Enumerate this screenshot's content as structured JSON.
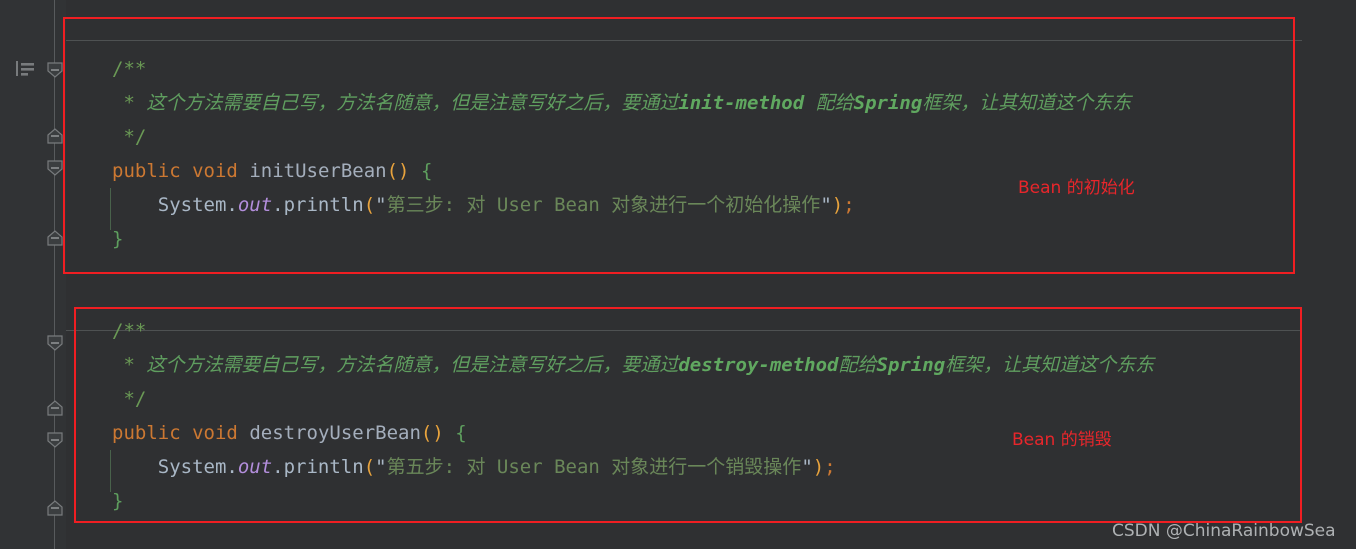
{
  "editor": {
    "theme_background": "#2F3032",
    "gutter_background": "#313335",
    "annotation_color": "#F01E22",
    "comment_color": "#5F9E5F",
    "keyword_color": "#CC7832",
    "string_color": "#6A8759"
  },
  "gutter": {
    "bookmark_icon": "bookmark-lines-icon",
    "fold_markers": [
      {
        "type": "fold-collapse-start"
      },
      {
        "type": "fold-collapse-end"
      },
      {
        "type": "fold-collapse-start"
      },
      {
        "type": "fold-collapse-end"
      },
      {
        "type": "fold-collapse-start"
      },
      {
        "type": "fold-collapse-end"
      },
      {
        "type": "fold-collapse-start"
      },
      {
        "type": "fold-collapse-end"
      }
    ]
  },
  "blocks": [
    {
      "id": "init-bean-block",
      "label": "Bean 的初始化",
      "lines": [
        {
          "id": "comment-open",
          "segments": [
            {
              "cls": "cmt-plain",
              "text": "/**"
            }
          ]
        },
        {
          "id": "comment-body",
          "segments": [
            {
              "cls": "cmt-plain",
              "text": " * "
            },
            {
              "cls": "cmt",
              "text": "这个方法需要自己写，方法名随意，但是注意写好之后，要通过"
            },
            {
              "cls": "cmt-b",
              "text": "init-method"
            },
            {
              "cls": "cmt",
              "text": " 配给"
            },
            {
              "cls": "cmt-b",
              "text": "Spring"
            },
            {
              "cls": "cmt",
              "text": "框架，让其知道这个东东"
            }
          ]
        },
        {
          "id": "comment-close",
          "segments": [
            {
              "cls": "cmt-plain",
              "text": " */"
            }
          ]
        },
        {
          "id": "method-signature",
          "segments": [
            {
              "cls": "kw",
              "text": "public"
            },
            {
              "cls": "ident",
              "text": " "
            },
            {
              "cls": "kw",
              "text": "void"
            },
            {
              "cls": "ident",
              "text": " "
            },
            {
              "cls": "mname",
              "text": "initUserBean"
            },
            {
              "cls": "paren",
              "text": "()"
            },
            {
              "cls": "ident",
              "text": " "
            },
            {
              "cls": "brace",
              "text": "{"
            }
          ]
        },
        {
          "id": "println-statement",
          "segments": [
            {
              "cls": "ident",
              "text": "    System."
            },
            {
              "cls": "field",
              "text": "out"
            },
            {
              "cls": "ident",
              "text": ".println"
            },
            {
              "cls": "paren",
              "text": "("
            },
            {
              "cls": "ident",
              "text": "\""
            },
            {
              "cls": "str",
              "text": "第三步: 对 User Bean 对象进行一个初始化操作"
            },
            {
              "cls": "ident",
              "text": "\""
            },
            {
              "cls": "paren",
              "text": ")"
            },
            {
              "cls": "semi",
              "text": ";"
            }
          ]
        },
        {
          "id": "method-close",
          "segments": [
            {
              "cls": "brace",
              "text": "}"
            }
          ]
        }
      ]
    },
    {
      "id": "destroy-bean-block",
      "label": "Bean 的销毁",
      "lines": [
        {
          "id": "comment-open",
          "segments": [
            {
              "cls": "cmt-plain",
              "text": "/**"
            }
          ]
        },
        {
          "id": "comment-body",
          "segments": [
            {
              "cls": "cmt-plain",
              "text": " * "
            },
            {
              "cls": "cmt",
              "text": "这个方法需要自己写，方法名随意，但是注意写好之后，要通过"
            },
            {
              "cls": "cmt-b",
              "text": "destroy-method"
            },
            {
              "cls": "cmt",
              "text": "配给"
            },
            {
              "cls": "cmt-b",
              "text": "Spring"
            },
            {
              "cls": "cmt",
              "text": "框架，让其知道这个东东"
            }
          ]
        },
        {
          "id": "comment-close",
          "segments": [
            {
              "cls": "cmt-plain",
              "text": " */"
            }
          ]
        },
        {
          "id": "method-signature",
          "segments": [
            {
              "cls": "kw",
              "text": "public"
            },
            {
              "cls": "ident",
              "text": " "
            },
            {
              "cls": "kw",
              "text": "void"
            },
            {
              "cls": "ident",
              "text": " "
            },
            {
              "cls": "mname",
              "text": "destroyUserBean"
            },
            {
              "cls": "paren",
              "text": "()"
            },
            {
              "cls": "ident",
              "text": " "
            },
            {
              "cls": "brace",
              "text": "{"
            }
          ]
        },
        {
          "id": "println-statement",
          "segments": [
            {
              "cls": "ident",
              "text": "    System."
            },
            {
              "cls": "field",
              "text": "out"
            },
            {
              "cls": "ident",
              "text": ".println"
            },
            {
              "cls": "paren",
              "text": "("
            },
            {
              "cls": "ident",
              "text": "\""
            },
            {
              "cls": "str",
              "text": "第五步: 对 User Bean 对象进行一个销毁操作"
            },
            {
              "cls": "ident",
              "text": "\""
            },
            {
              "cls": "paren",
              "text": ")"
            },
            {
              "cls": "semi",
              "text": ";"
            }
          ]
        },
        {
          "id": "method-close",
          "segments": [
            {
              "cls": "brace",
              "text": "}"
            }
          ]
        }
      ]
    }
  ],
  "watermark": "CSDN @ChinaRainbowSea"
}
